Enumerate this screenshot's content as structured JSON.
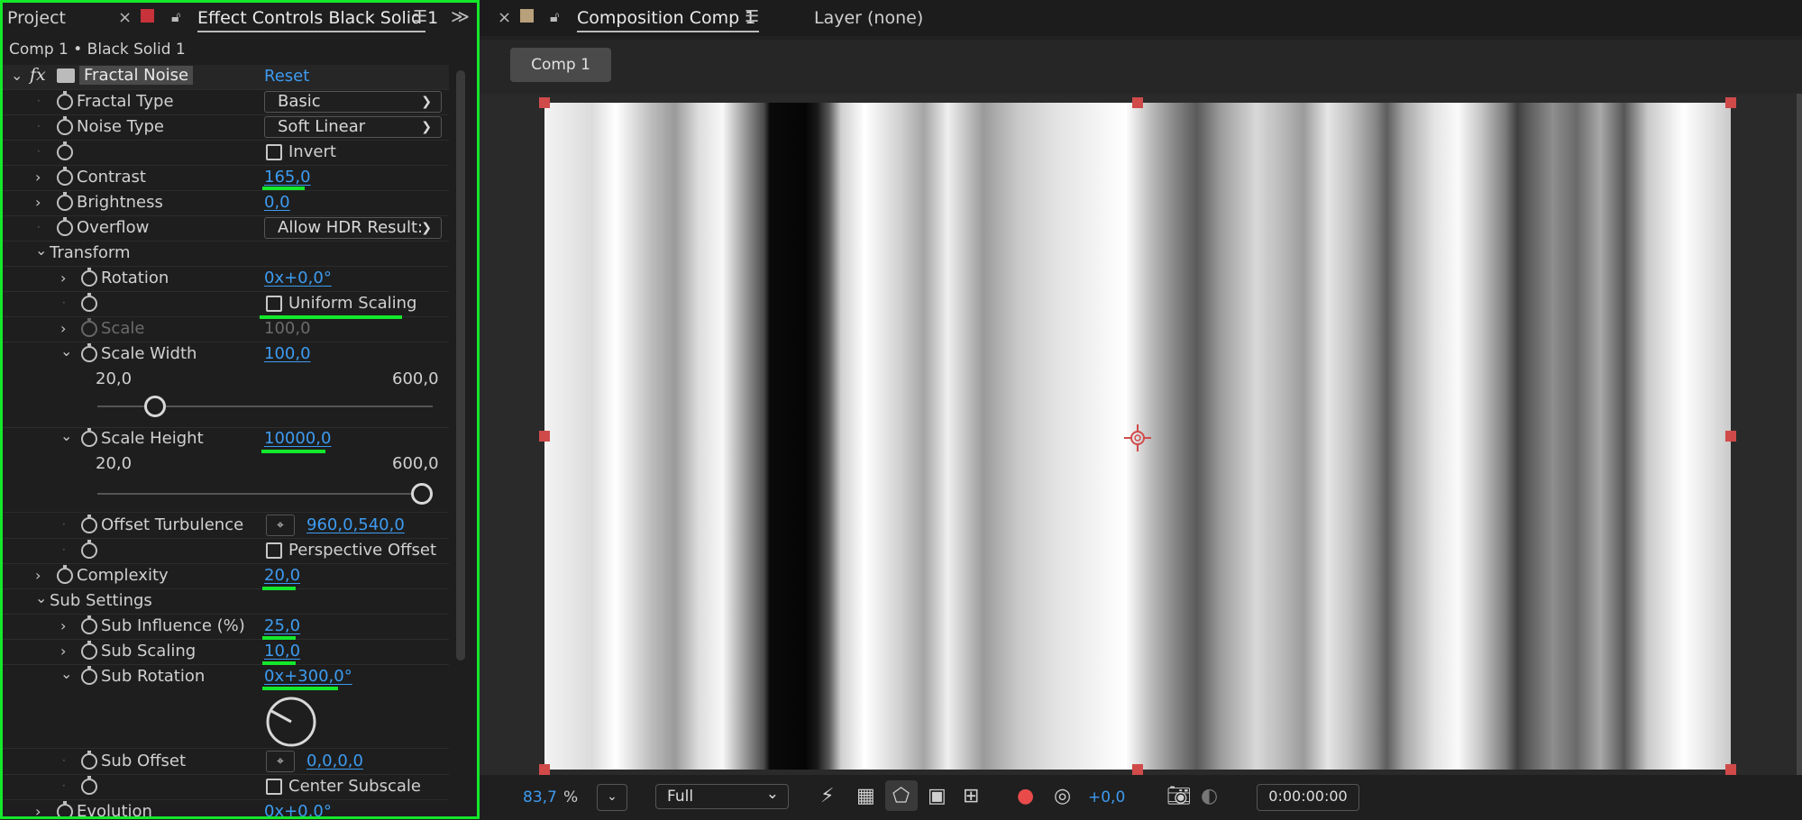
{
  "left_panel": {
    "tab_project": "Project",
    "tab_effect_controls": "Effect Controls Black Solid 1",
    "breadcrumb": "Comp 1 • Black Solid 1",
    "effect": {
      "name": "Fractal Noise",
      "reset": "Reset",
      "fx_label": "fx"
    },
    "props": {
      "fractal_type": {
        "label": "Fractal Type",
        "value": "Basic"
      },
      "noise_type": {
        "label": "Noise Type",
        "value": "Soft Linear"
      },
      "invert": {
        "label": "Invert"
      },
      "contrast": {
        "label": "Contrast",
        "value": "165,0"
      },
      "brightness": {
        "label": "Brightness",
        "value": "0,0"
      },
      "overflow": {
        "label": "Overflow",
        "value": "Allow HDR Result:"
      },
      "transform": {
        "label": "Transform"
      },
      "rotation": {
        "label": "Rotation",
        "value": "0x+0,0°"
      },
      "uniform_scaling": {
        "label": "Uniform Scaling"
      },
      "scale": {
        "label": "Scale",
        "value": "100,0"
      },
      "scale_width": {
        "label": "Scale Width",
        "value": "100,0",
        "min": "20,0",
        "max": "600,0",
        "slider_fraction": 0.15
      },
      "scale_height": {
        "label": "Scale Height",
        "value": "10000,0",
        "min": "20,0",
        "max": "600,0",
        "slider_fraction": 1.0
      },
      "offset_turbulence": {
        "label": "Offset Turbulence",
        "value": "960,0,540,0"
      },
      "perspective_offset": {
        "label": "Perspective Offset"
      },
      "complexity": {
        "label": "Complexity",
        "value": "20,0"
      },
      "sub_settings": {
        "label": "Sub Settings"
      },
      "sub_influence": {
        "label": "Sub Influence (%)",
        "value": "25,0"
      },
      "sub_scaling": {
        "label": "Sub Scaling",
        "value": "10,0"
      },
      "sub_rotation": {
        "label": "Sub Rotation",
        "value": "0x+300,0°"
      },
      "sub_offset": {
        "label": "Sub Offset",
        "value": "0,0,0,0"
      },
      "center_subscale": {
        "label": "Center Subscale"
      },
      "evolution": {
        "label": "Evolution",
        "value": "0x+0,0°"
      }
    }
  },
  "right_panel": {
    "tab_composition": "Composition Comp 1",
    "layer_label": "Layer (none)",
    "comp_tab": "Comp 1",
    "footer": {
      "zoom": "83,7",
      "zoom_unit": "%",
      "resolution": "Full",
      "exposure": "+0,0",
      "timecode": "0:00:00:00"
    }
  },
  "colors": {
    "accent_blue": "#3d9bf0",
    "highlight_green": "#14e82b",
    "handle_red": "#d04a4a"
  }
}
